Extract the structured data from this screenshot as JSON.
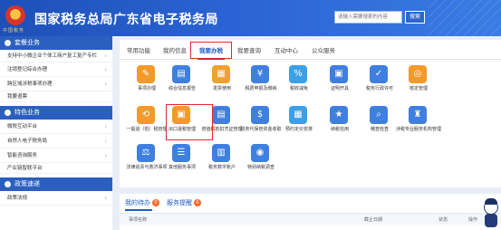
{
  "header": {
    "title": "国家税务总局广东省电子税务局",
    "emblem_text": "中国税务",
    "search_placeholder": "请输入需要搜索的内容",
    "search_button": "搜索"
  },
  "sidebar": {
    "sections": [
      {
        "label": "套餐业务",
        "items": [
          "支持中小微企业个体工商户复工复产专栏",
          "注销登记综合办理",
          "跨区域涉税事项办理",
          "我要退票"
        ]
      },
      {
        "label": "特色业务",
        "items": [
          "微税互动平台",
          "自然人电子税务局",
          "智能咨询服务",
          "产业链智联平台"
        ]
      },
      {
        "label": "政策速递",
        "items": [
          "政策法规"
        ]
      }
    ]
  },
  "main": {
    "tabs": [
      "常用功能",
      "我的信息",
      "我要办税",
      "我要查询",
      "互动中心",
      "公众服务"
    ],
    "active_tab": "我要办税",
    "items": [
      {
        "label": "事项办理",
        "icon": "pencil-icon",
        "color": "#f39a2b"
      },
      {
        "label": "综合信息报告",
        "icon": "document-icon",
        "color": "#3e7fe0"
      },
      {
        "label": "发票使用",
        "icon": "invoice-icon",
        "color": "#f0a22e"
      },
      {
        "label": "税费申报及缴纳",
        "icon": "tax-return-icon",
        "color": "#3e7fe0"
      },
      {
        "label": "税收减免",
        "icon": "reduction-icon",
        "color": "#3aa0e8"
      },
      {
        "label": "证明开具",
        "icon": "certificate-icon",
        "color": "#3e7fe0"
      },
      {
        "label": "税务行政许可",
        "icon": "license-icon",
        "color": "#3e7fe0"
      },
      {
        "label": "核定管理",
        "icon": "verify-icon",
        "color": "#f39a2b"
      },
      {
        "label": "一般退（抵）税管理",
        "icon": "refund-icon",
        "color": "#f39a2b"
      },
      {
        "label": "出口退税管理",
        "icon": "export-refund-icon",
        "color": "#f39a2b"
      },
      {
        "label": "增值税抵扣凭证管理",
        "icon": "voucher-icon",
        "color": "#3e7fe0"
      },
      {
        "label": "税务代保管资金收取",
        "icon": "funds-icon",
        "color": "#3e7fe0"
      },
      {
        "label": "预约定价安排",
        "icon": "calendar-icon",
        "color": "#3aa0e8"
      },
      {
        "label": "纳税信用",
        "icon": "credit-icon",
        "color": "#3e7fe0"
      },
      {
        "label": "稽查检查",
        "icon": "inspection-icon",
        "color": "#3e7fe0"
      },
      {
        "label": "涉税专业服务机构管理",
        "icon": "agency-icon",
        "color": "#3e7fe0"
      },
      {
        "label": "法律追责与救济事项",
        "icon": "law-icon",
        "color": "#3e7fe0"
      },
      {
        "label": "其他服务事项",
        "icon": "service-icon",
        "color": "#3e7fe0"
      },
      {
        "label": "税务数字账户",
        "icon": "account-icon",
        "color": "#3e7fe0"
      },
      {
        "label": "特别纳税调查",
        "icon": "investigation-icon",
        "color": "#3e7fe0"
      }
    ]
  },
  "bottom": {
    "tabs": [
      {
        "label": "我的待办",
        "count": "0"
      },
      {
        "label": "服务提醒",
        "count": "0"
      }
    ],
    "columns": [
      "事项名称",
      "截止日期",
      "状态",
      "操作"
    ]
  }
}
